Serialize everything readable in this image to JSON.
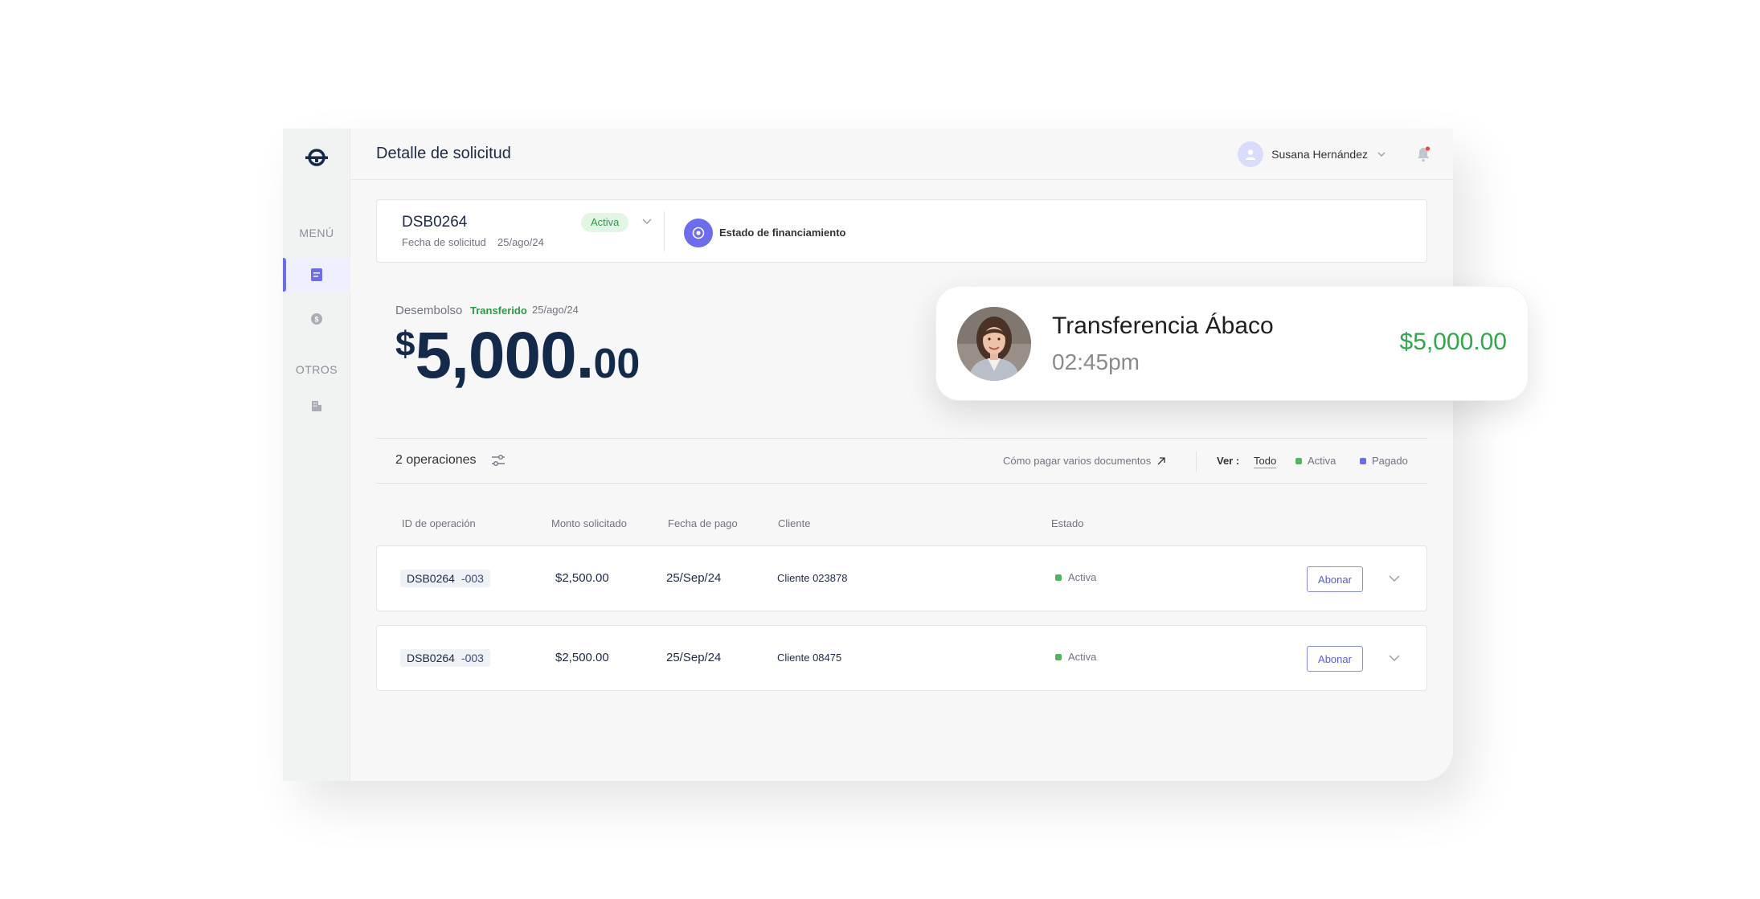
{
  "header": {
    "page_title": "Detalle de solicitud",
    "user_name": "Susana Hernández"
  },
  "sidebar": {
    "menu_label": "MENÚ",
    "others_label": "OTROS",
    "items": [
      {
        "icon": "document-icon",
        "active": true
      },
      {
        "icon": "coin-icon",
        "active": false
      },
      {
        "icon": "building-icon",
        "active": false
      }
    ]
  },
  "request": {
    "id": "DSB0264",
    "date_label": "Fecha de solicitud",
    "date": "25/ago/24",
    "status": "Activa",
    "financing_label": "Estado de financiamiento"
  },
  "disbursement": {
    "label": "Desembolso",
    "status": "Transferido",
    "date": "25/ago/24",
    "currency": "$",
    "amount_int": "5,000.",
    "amount_dec": "00"
  },
  "operations_bar": {
    "count": "2 operaciones",
    "how_to_pay": "Cómo pagar varios documentos",
    "ver_label": "Ver :",
    "ver_todo": "Todo",
    "legend_activa": "Activa",
    "legend_pagado": "Pagado"
  },
  "table": {
    "headers": [
      "ID de operación",
      "Monto solicitado",
      "Fecha de pago",
      "Cliente",
      "Estado"
    ],
    "rows": [
      {
        "id": "DSB0264",
        "suffix": "-003",
        "monto": "$2,500.00",
        "fecha": "25/Sep/24",
        "cliente": "Cliente 023878",
        "estado": "Activa",
        "action": "Abonar"
      },
      {
        "id": "DSB0264",
        "suffix": "-003",
        "monto": "$2,500.00",
        "fecha": "25/Sep/24",
        "cliente": "Cliente 08475",
        "estado": "Activa",
        "action": "Abonar"
      }
    ]
  },
  "toast": {
    "title": "Transferencia Ábaco",
    "time": "02:45pm",
    "amount": "$5,000.00"
  },
  "colors": {
    "accent": "#6c6cf0",
    "success": "#2ea84a",
    "active_dot": "#4cb860",
    "paid_dot": "#6c6cf0"
  }
}
